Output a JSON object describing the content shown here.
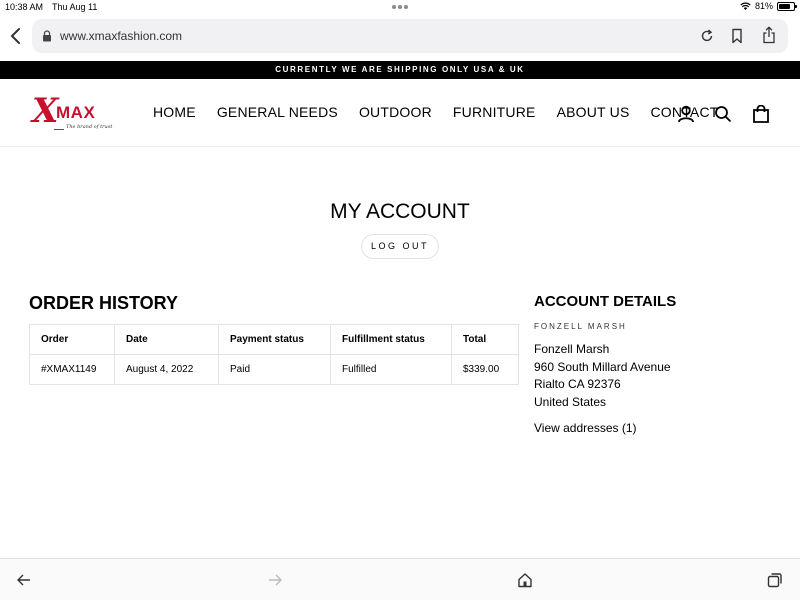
{
  "status_bar": {
    "time": "10:38 AM",
    "date": "Thu Aug 11",
    "battery": "81%",
    "battery_level": 0.81
  },
  "browser": {
    "url": "www.xmaxfashion.com"
  },
  "announcement": "CURRENTLY WE ARE SHIPPING ONLY USA & UK",
  "logo": {
    "letter": "X",
    "text": "MAX",
    "tagline": "The brand of trust"
  },
  "nav": [
    "HOME",
    "GENERAL NEEDS",
    "OUTDOOR",
    "FURNITURE",
    "ABOUT US",
    "CONTACT"
  ],
  "page": {
    "title": "MY ACCOUNT",
    "logout_label": "LOG OUT"
  },
  "orders": {
    "heading": "ORDER HISTORY",
    "columns": [
      "Order",
      "Date",
      "Payment status",
      "Fulfillment status",
      "Total"
    ],
    "rows": [
      [
        "#XMAX1149",
        "August 4, 2022",
        "Paid",
        "Fulfilled",
        "$339.00"
      ]
    ]
  },
  "account": {
    "heading": "ACCOUNT DETAILS",
    "name_caps": "FONZELL MARSH",
    "address_lines": [
      "Fonzell Marsh",
      "960 South Millard Avenue",
      "Rialto CA 92376",
      "United States"
    ],
    "view_addresses": "View addresses (1)"
  },
  "colors": {
    "brand_red": "#c8102e",
    "announcement_bg": "#000000"
  }
}
